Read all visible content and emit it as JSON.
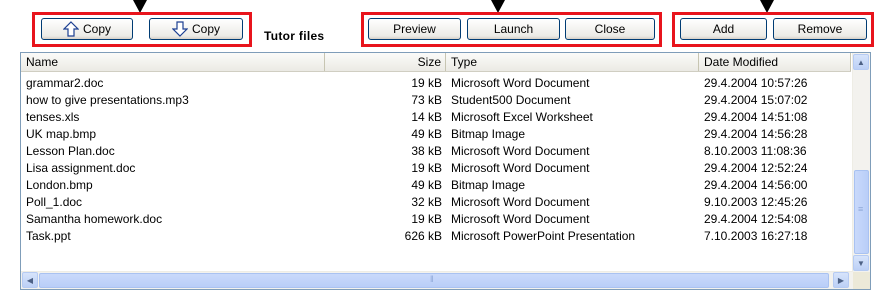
{
  "toolbar": {
    "copy_up_label": "Copy",
    "copy_down_label": "Copy",
    "section_label": "Tutor files",
    "preview_label": "Preview",
    "launch_label": "Launch",
    "close_label": "Close",
    "add_label": "Add",
    "remove_label": "Remove"
  },
  "list": {
    "columns": [
      "Name",
      "Size",
      "Type",
      "Date Modified"
    ],
    "rows": [
      {
        "name": "grammar2.doc",
        "size": "19 kB",
        "type": "Microsoft Word Document",
        "date": "29.4.2004 10:57:26"
      },
      {
        "name": "how to give presentations.mp3",
        "size": "73 kB",
        "type": "Student500 Document",
        "date": "29.4.2004 15:07:02"
      },
      {
        "name": "tenses.xls",
        "size": "14 kB",
        "type": "Microsoft Excel Worksheet",
        "date": "29.4.2004 14:51:08"
      },
      {
        "name": "UK map.bmp",
        "size": "49 kB",
        "type": "Bitmap Image",
        "date": "29.4.2004 14:56:28"
      },
      {
        "name": "Lesson Plan.doc",
        "size": "38 kB",
        "type": "Microsoft Word Document",
        "date": "8.10.2003 11:08:36"
      },
      {
        "name": "Lisa assignment.doc",
        "size": "19 kB",
        "type": "Microsoft Word Document",
        "date": "29.4.2004 12:52:24"
      },
      {
        "name": "London.bmp",
        "size": "49 kB",
        "type": "Bitmap Image",
        "date": "29.4.2004 14:56:00"
      },
      {
        "name": "Poll_1.doc",
        "size": "32 kB",
        "type": "Microsoft Word Document",
        "date": "9.10.2003 12:45:26"
      },
      {
        "name": "Samantha homework.doc",
        "size": "19 kB",
        "type": "Microsoft Word Document",
        "date": "29.4.2004 12:54:08"
      },
      {
        "name": "Task.ppt",
        "size": "626 kB",
        "type": "Microsoft PowerPoint Presentation",
        "date": "7.10.2003 16:27:18"
      }
    ]
  },
  "colors": {
    "annotation": "#e8141c",
    "accent": "#316ac5"
  }
}
